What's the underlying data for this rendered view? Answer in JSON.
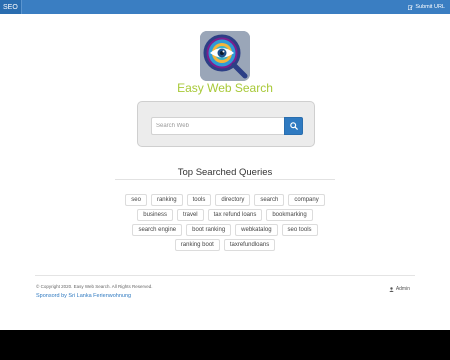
{
  "header": {
    "brand": "SEO",
    "submit_label": "Submit URL",
    "submit_icon": "edit-icon"
  },
  "logo": {
    "icon": "eye-magnifier-logo"
  },
  "site": {
    "title": "Easy Web Search"
  },
  "search": {
    "placeholder": "Search Web",
    "value": "",
    "button_icon": "search-icon"
  },
  "queries": {
    "title": "Top Searched Queries",
    "rows": [
      [
        "seo",
        "ranking",
        "tools",
        "directory",
        "search",
        "company"
      ],
      [
        "business",
        "travel",
        "tax refund loans",
        "bookmarking"
      ],
      [
        "search engine",
        "boot ranking",
        "webkatalog",
        "seo tools"
      ],
      [
        "ranking boot",
        "taxrefundloans"
      ]
    ]
  },
  "footer": {
    "copyright": "© Copyright 2020. Easy Web Search. All Rights Reserved.",
    "sponsor": "Sponsord by Sri Lanka Ferienwohnung",
    "admin_label": "Admin",
    "admin_icon": "user-icon"
  },
  "colors": {
    "topbar": "#3a7ec2",
    "title": "#a8c938",
    "button": "#2f7ac1",
    "link": "#2f7ac1"
  }
}
